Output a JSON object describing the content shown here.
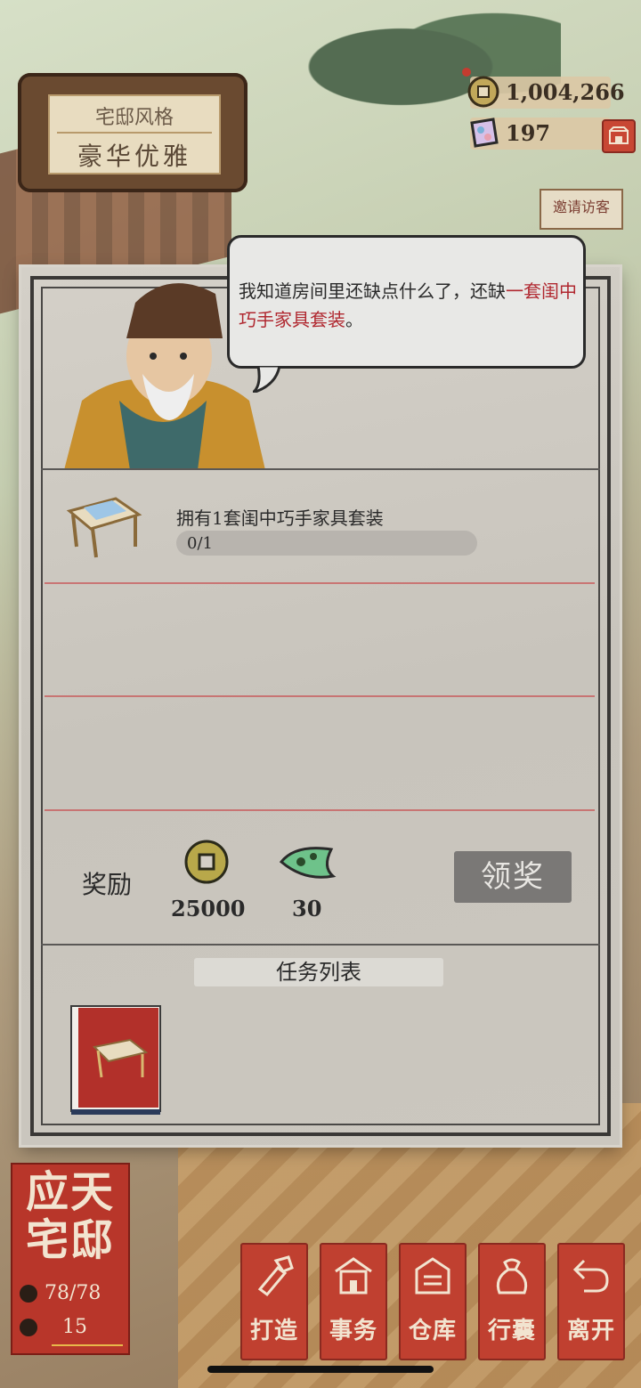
{
  "style_badge": {
    "label": "宅邸风格",
    "value": "豪华优雅"
  },
  "currency": {
    "coins": "1,004,266",
    "gems": "197"
  },
  "invite_label": "邀请访客",
  "dialog": {
    "text_plain": "我知道房间里还缺点什么了，还缺",
    "text_highlight": "一套闺中巧手家具套装",
    "text_end": "。"
  },
  "task": {
    "title": "拥有1套闺中巧手家具套装",
    "progress_text": "0/1",
    "progress_value": 0
  },
  "reward": {
    "label": "奖励",
    "coins": "25000",
    "jade": "30",
    "claim_label": "领奖"
  },
  "task_list_title": "任务列表",
  "mansion": {
    "name_line1": "应天",
    "name_line2": "宅邸",
    "population": "78/78",
    "count": "15"
  },
  "nav": [
    {
      "label": "打造",
      "icon": "hammer-icon"
    },
    {
      "label": "事务",
      "icon": "building-icon"
    },
    {
      "label": "仓库",
      "icon": "warehouse-icon"
    },
    {
      "label": "行囊",
      "icon": "bag-icon"
    },
    {
      "label": "离开",
      "icon": "return-icon"
    }
  ],
  "colors": {
    "accent_red": "#c04030",
    "highlight_text": "#b02830"
  }
}
